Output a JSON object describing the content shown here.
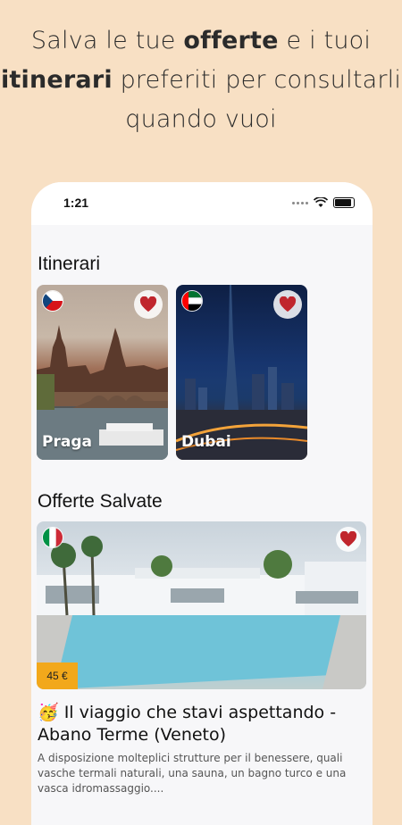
{
  "headline": {
    "part1": "Salva le tue ",
    "bold1": "offerte",
    "part2": " e i tuoi ",
    "bold2": "itinerari",
    "part3": " preferiti per consultarli quando vuoi"
  },
  "status_bar": {
    "time": "1:21"
  },
  "itinerari": {
    "title": "Itinerari",
    "items": [
      {
        "label": "Praga",
        "flag": "czech-flag-icon"
      },
      {
        "label": "Dubai",
        "flag": "uae-flag-icon"
      }
    ]
  },
  "offerte": {
    "title": "Offerte Salvate",
    "items": [
      {
        "flag": "italy-flag-icon",
        "price": "45 €",
        "title": "🥳 Il viaggio che stavi aspettando - Abano Terme (Veneto)",
        "description": "A disposizione molteplici strutture per il benessere, quali vasche termali naturali, una sauna, un bagno turco e una vasca idromassaggio...."
      }
    ]
  },
  "colors": {
    "background": "#f8e0c4",
    "heart": "#c0262d",
    "price_tag": "#f2a81b"
  }
}
